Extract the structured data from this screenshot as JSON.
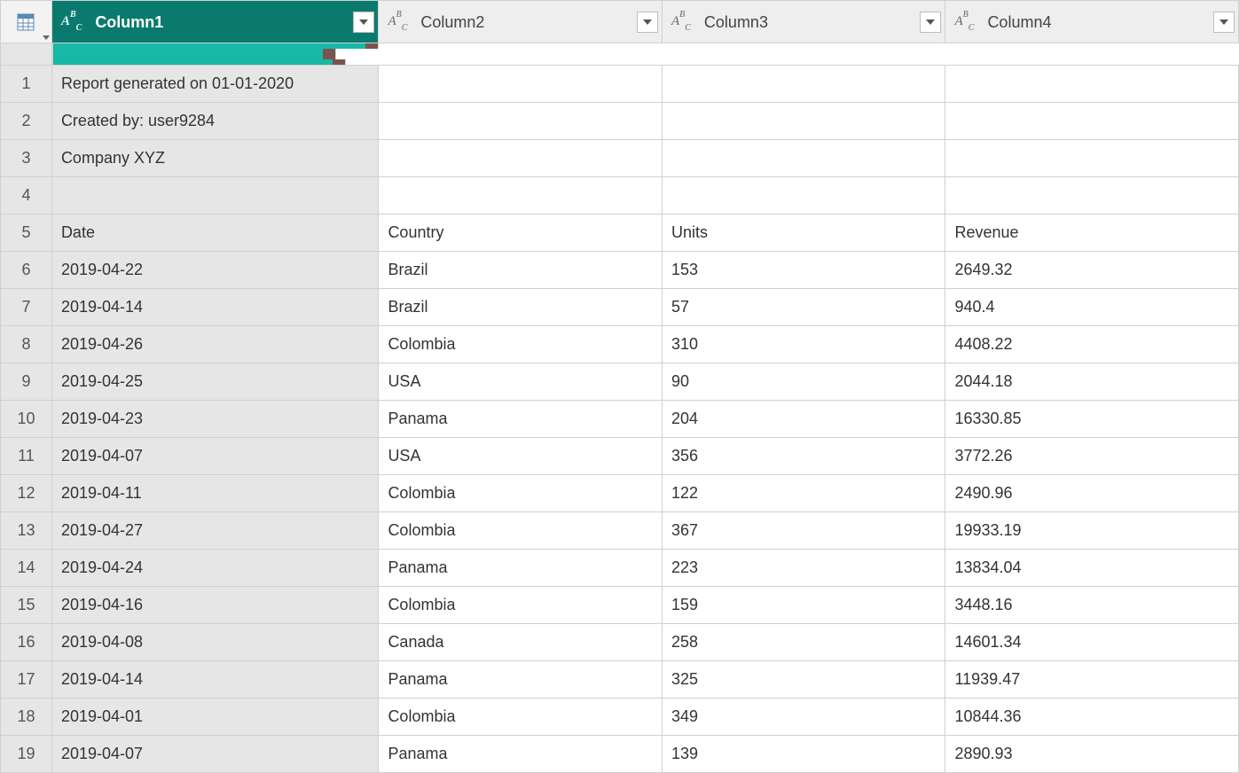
{
  "columns": [
    {
      "name": "Column1",
      "type_label": "ABC",
      "selected": true
    },
    {
      "name": "Column2",
      "type_label": "ABC",
      "selected": false
    },
    {
      "name": "Column3",
      "type_label": "ABC",
      "selected": false
    },
    {
      "name": "Column4",
      "type_label": "ABC",
      "selected": false
    }
  ],
  "rows": [
    {
      "n": "1",
      "c": [
        "Report generated on 01-01-2020",
        "",
        "",
        ""
      ]
    },
    {
      "n": "2",
      "c": [
        "Created by: user9284",
        "",
        "",
        ""
      ]
    },
    {
      "n": "3",
      "c": [
        "Company XYZ",
        "",
        "",
        ""
      ]
    },
    {
      "n": "4",
      "c": [
        "",
        "",
        "",
        ""
      ]
    },
    {
      "n": "5",
      "c": [
        "Date",
        "Country",
        "Units",
        "Revenue"
      ]
    },
    {
      "n": "6",
      "c": [
        "2019-04-22",
        "Brazil",
        "153",
        "2649.32"
      ]
    },
    {
      "n": "7",
      "c": [
        "2019-04-14",
        "Brazil",
        "57",
        "940.4"
      ]
    },
    {
      "n": "8",
      "c": [
        "2019-04-26",
        "Colombia",
        "310",
        "4408.22"
      ]
    },
    {
      "n": "9",
      "c": [
        "2019-04-25",
        "USA",
        "90",
        "2044.18"
      ]
    },
    {
      "n": "10",
      "c": [
        "2019-04-23",
        "Panama",
        "204",
        "16330.85"
      ]
    },
    {
      "n": "11",
      "c": [
        "2019-04-07",
        "USA",
        "356",
        "3772.26"
      ]
    },
    {
      "n": "12",
      "c": [
        "2019-04-11",
        "Colombia",
        "122",
        "2490.96"
      ]
    },
    {
      "n": "13",
      "c": [
        "2019-04-27",
        "Colombia",
        "367",
        "19933.19"
      ]
    },
    {
      "n": "14",
      "c": [
        "2019-04-24",
        "Panama",
        "223",
        "13834.04"
      ]
    },
    {
      "n": "15",
      "c": [
        "2019-04-16",
        "Colombia",
        "159",
        "3448.16"
      ]
    },
    {
      "n": "16",
      "c": [
        "2019-04-08",
        "Canada",
        "258",
        "14601.34"
      ]
    },
    {
      "n": "17",
      "c": [
        "2019-04-14",
        "Panama",
        "325",
        "11939.47"
      ]
    },
    {
      "n": "18",
      "c": [
        "2019-04-01",
        "Colombia",
        "349",
        "10844.36"
      ]
    },
    {
      "n": "19",
      "c": [
        "2019-04-07",
        "Panama",
        "139",
        "2890.93"
      ]
    }
  ]
}
